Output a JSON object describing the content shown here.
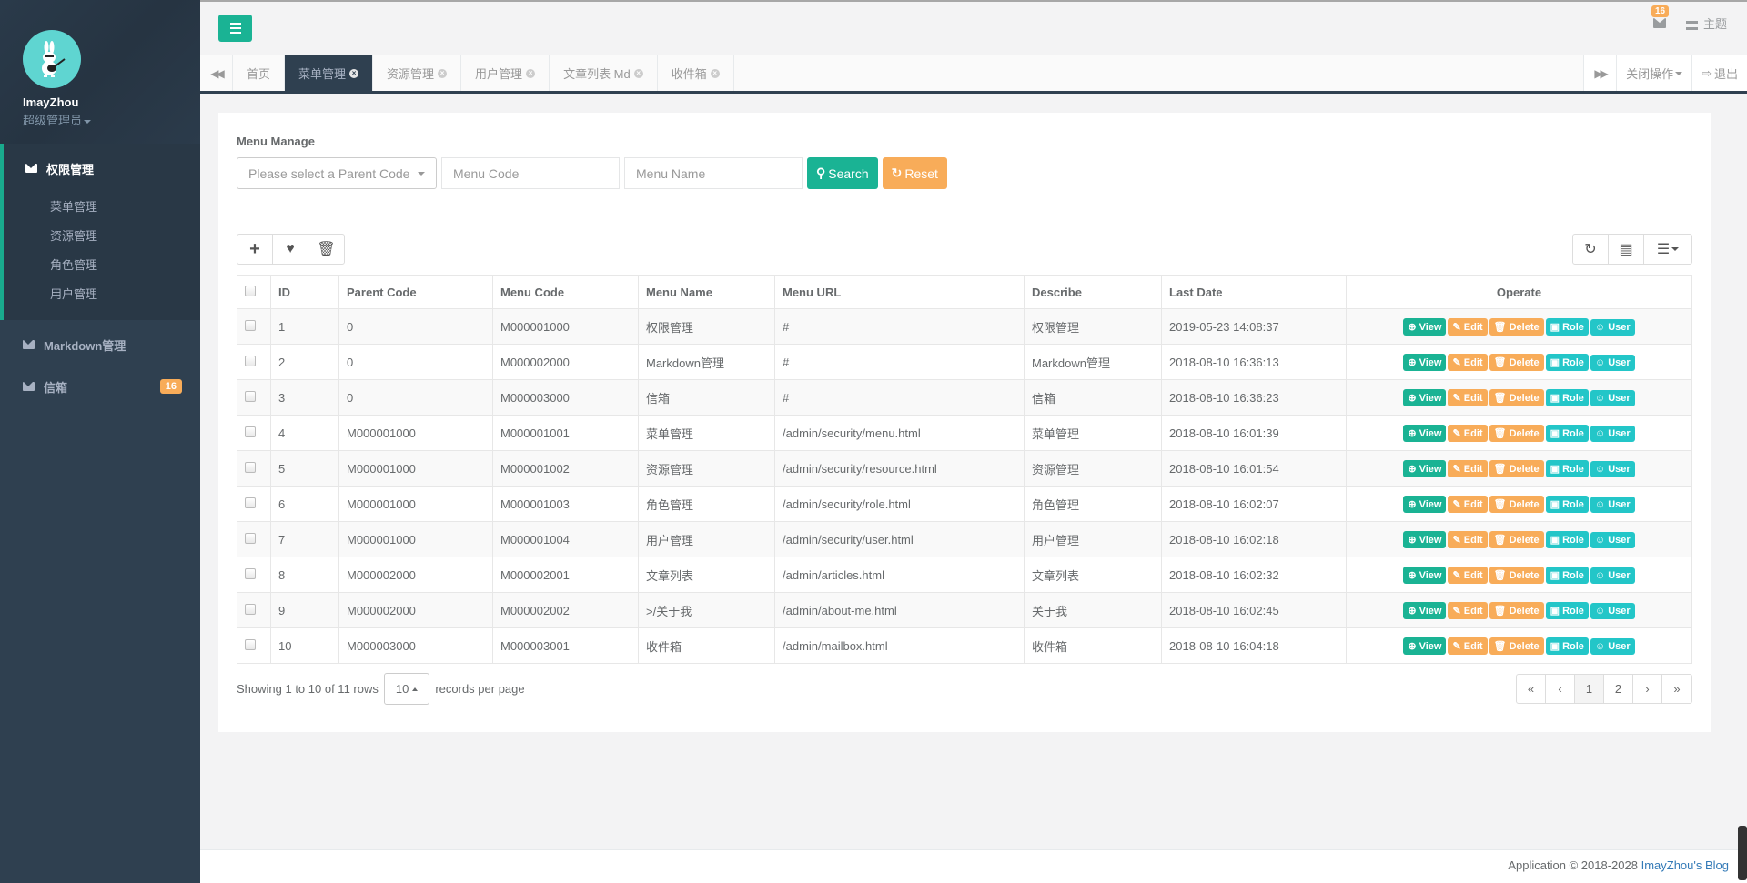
{
  "sidebar": {
    "user_name": "ImayZhou",
    "user_role": "超级管理员",
    "groups": [
      {
        "label": "权限管理",
        "icon": "envelope-icon",
        "expanded": true,
        "children": [
          "菜单管理",
          "资源管理",
          "角色管理",
          "用户管理"
        ]
      }
    ],
    "items": [
      {
        "label": "Markdown管理",
        "icon": "envelope-icon"
      },
      {
        "label": "信箱",
        "icon": "envelope-icon",
        "badge": "16"
      }
    ]
  },
  "topbar": {
    "mail_badge": "16",
    "theme_label": "主题"
  },
  "tabs": {
    "items": [
      {
        "label": "首页",
        "closable": false,
        "active": false
      },
      {
        "label": "菜单管理",
        "closable": true,
        "active": true
      },
      {
        "label": "资源管理",
        "closable": true,
        "active": false
      },
      {
        "label": "用户管理",
        "closable": true,
        "active": false
      },
      {
        "label": "文章列表 Md",
        "closable": true,
        "active": false
      },
      {
        "label": "收件箱",
        "closable": true,
        "active": false
      }
    ],
    "close_ops_label": "关闭操作",
    "logout_label": "退出"
  },
  "panel": {
    "title": "Menu Manage",
    "parent_select_placeholder": "Please select a Parent Code",
    "menu_code_placeholder": "Menu Code",
    "menu_name_placeholder": "Menu Name",
    "search_label": "Search",
    "reset_label": "Reset"
  },
  "table": {
    "columns": [
      "ID",
      "Parent Code",
      "Menu Code",
      "Menu Name",
      "Menu URL",
      "Describe",
      "Last Date",
      "Operate"
    ],
    "rows": [
      {
        "id": "1",
        "parent": "0",
        "code": "M000001000",
        "name": "权限管理",
        "url": "#",
        "desc": "权限管理",
        "date": "2019-05-23 14:08:37"
      },
      {
        "id": "2",
        "parent": "0",
        "code": "M000002000",
        "name": "Markdown管理",
        "url": "#",
        "desc": "Markdown管理",
        "date": "2018-08-10 16:36:13"
      },
      {
        "id": "3",
        "parent": "0",
        "code": "M000003000",
        "name": "信箱",
        "url": "#",
        "desc": "信箱",
        "date": "2018-08-10 16:36:23"
      },
      {
        "id": "4",
        "parent": "M000001000",
        "code": "M000001001",
        "name": "菜单管理",
        "url": "/admin/security/menu.html",
        "desc": "菜单管理",
        "date": "2018-08-10 16:01:39"
      },
      {
        "id": "5",
        "parent": "M000001000",
        "code": "M000001002",
        "name": "资源管理",
        "url": "/admin/security/resource.html",
        "desc": "资源管理",
        "date": "2018-08-10 16:01:54"
      },
      {
        "id": "6",
        "parent": "M000001000",
        "code": "M000001003",
        "name": "角色管理",
        "url": "/admin/security/role.html",
        "desc": "角色管理",
        "date": "2018-08-10 16:02:07"
      },
      {
        "id": "7",
        "parent": "M000001000",
        "code": "M000001004",
        "name": "用户管理",
        "url": "/admin/security/user.html",
        "desc": "用户管理",
        "date": "2018-08-10 16:02:18"
      },
      {
        "id": "8",
        "parent": "M000002000",
        "code": "M000002001",
        "name": "文章列表",
        "url": "/admin/articles.html",
        "desc": "文章列表",
        "date": "2018-08-10 16:02:32"
      },
      {
        "id": "9",
        "parent": "M000002000",
        "code": "M000002002",
        "name": ">/关于我",
        "url": "/admin/about-me.html",
        "desc": "关于我",
        "date": "2018-08-10 16:02:45"
      },
      {
        "id": "10",
        "parent": "M000003000",
        "code": "M000003001",
        "name": "收件箱",
        "url": "/admin/mailbox.html",
        "desc": "收件箱",
        "date": "2018-08-10 16:04:18"
      }
    ],
    "actions": [
      "View",
      "Edit",
      "Delete",
      "Role",
      "User"
    ]
  },
  "pager": {
    "info": "Showing 1 to 10 of 11 rows",
    "page_size": "10",
    "per_page_label": "records per page",
    "pages": [
      "«",
      "‹",
      "1",
      "2",
      "›",
      "»"
    ],
    "current_page": "1"
  },
  "footer": {
    "text": "Application © 2018-2028 ",
    "link": "ImayZhou's Blog"
  },
  "colors": {
    "primary": "#1ab394",
    "warning": "#f8ac59",
    "info": "#23c6c8",
    "sidebar": "#2f4050"
  }
}
